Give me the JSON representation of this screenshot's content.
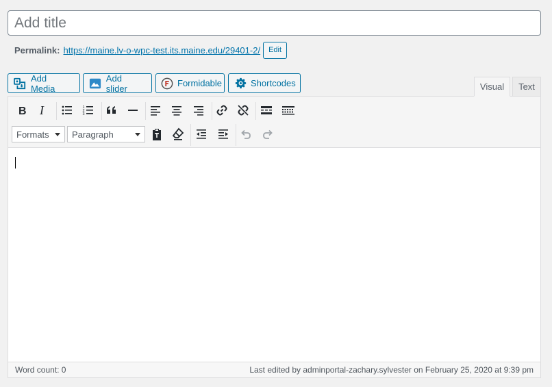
{
  "title": {
    "placeholder": "Add title"
  },
  "permalink": {
    "label": "Permalink:",
    "url": "https://maine.lv-o-wpc-test.its.maine.edu/29401-2/",
    "edit_label": "Edit"
  },
  "media_buttons": [
    {
      "label": "Add Media",
      "icon": "add-media-icon"
    },
    {
      "label": "Add slider",
      "icon": "slider-icon"
    },
    {
      "label": "Formidable",
      "icon": "formidable-icon"
    },
    {
      "label": "Shortcodes",
      "icon": "gear-icon"
    }
  ],
  "tabs": {
    "visual": "Visual",
    "text": "Text",
    "active": "visual"
  },
  "toolbar": {
    "row1": [
      "bold-icon",
      "italic-icon",
      "bulleted-list-icon",
      "numbered-list-icon",
      "blockquote-icon",
      "horizontal-line-icon",
      "align-left-icon",
      "align-center-icon",
      "align-right-icon",
      "link-icon",
      "unlink-icon",
      "read-more-icon",
      "toolbar-toggle-icon"
    ],
    "formats_label": "Formats",
    "paragraph_label": "Paragraph",
    "row2": [
      "paste-text-icon",
      "clear-formatting-icon",
      "outdent-icon",
      "indent-icon",
      "undo-icon",
      "redo-icon"
    ]
  },
  "status": {
    "word_count": "Word count: 0",
    "last_edited": "Last edited by adminportal-zachary.sylvester on February 25, 2020 at 9:39 pm"
  },
  "colors": {
    "accent": "#0071a1",
    "link": "#0073aa",
    "border": "#dcdcde",
    "background": "#f1f1f1"
  }
}
